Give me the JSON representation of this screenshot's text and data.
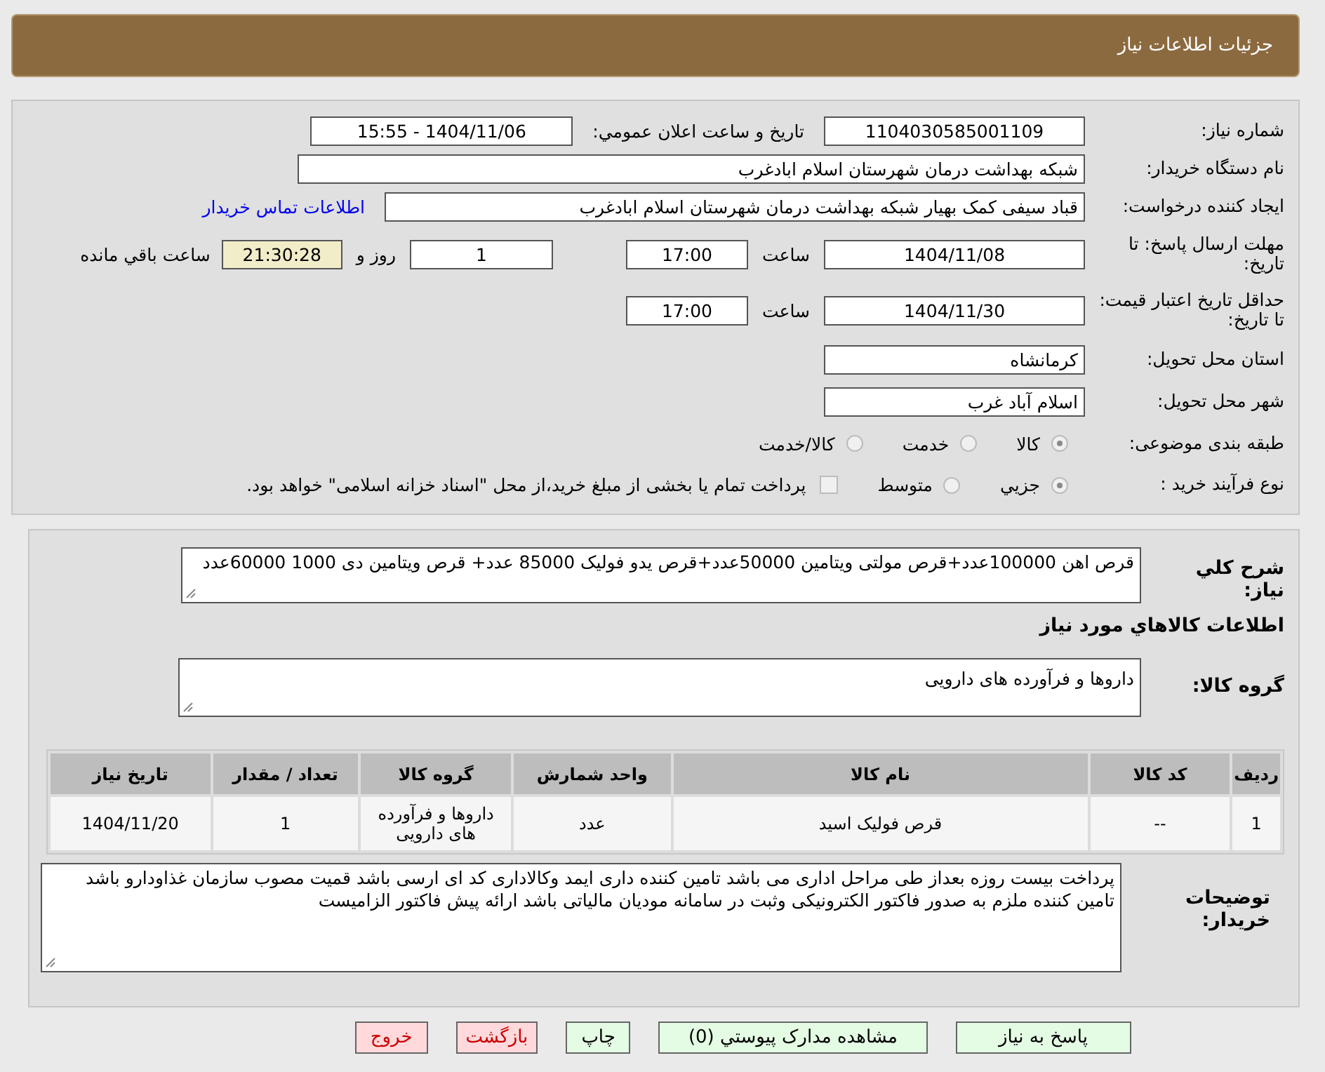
{
  "header": {
    "title": "جزئیات اطلاعات نیاز"
  },
  "need_number": {
    "label": "شماره نیاز:",
    "value": "1104030585001109"
  },
  "announce": {
    "label": "تاریخ و ساعت اعلان عمومي:",
    "value": "1404/11/06 - 15:55"
  },
  "buyer": {
    "label": "نام دستگاه خریدار:",
    "value": "شبکه بهداشت درمان شهرستان اسلام ابادغرب"
  },
  "requester": {
    "label": "ایجاد کننده درخواست:",
    "value": "قباد سیفی کمک بهیار شبکه بهداشت درمان شهرستان اسلام ابادغرب",
    "link": "اطلاعات تماس خریدار"
  },
  "reply_deadline": {
    "label": "مهلت ارسال پاسخ: تا تاریخ:",
    "date": "1404/11/08",
    "time_label": "ساعت",
    "time": "17:00",
    "days": "1",
    "days_label": "روز و",
    "remaining": "21:30:28",
    "remaining_label": "ساعت باقي مانده"
  },
  "price_validity": {
    "label": "حداقل تاریخ اعتبار قیمت: تا تاریخ:",
    "date": "1404/11/30",
    "time_label": "ساعت",
    "time": "17:00"
  },
  "province": {
    "label": "استان محل تحویل:",
    "value": "کرمانشاه"
  },
  "city": {
    "label": "شهر محل تحویل:",
    "value": "اسلام آباد غرب"
  },
  "category": {
    "label": "طبقه بندی موضوعی:",
    "options": [
      {
        "label": "کالا",
        "selected": true
      },
      {
        "label": "خدمت",
        "selected": false
      },
      {
        "label": "کالا/خدمت",
        "selected": false
      }
    ]
  },
  "process": {
    "label": "نوع فرآیند خرید :",
    "options": [
      {
        "label": "جزيي",
        "selected": true
      },
      {
        "label": "متوسط",
        "selected": false
      }
    ],
    "treasury": {
      "label": "پرداخت تمام یا بخشی از مبلغ خرید،از محل \"اسناد خزانه اسلامی\" خواهد بود.",
      "checked": false
    }
  },
  "summary": {
    "label": "شرح کلي نیاز:",
    "value": "قرص اهن 100000عدد+قرص مولتی ویتامین 50000عدد+قرص یدو فولیک 85000 عدد+ قرص ویتامین دی 1000 60000عدد"
  },
  "goods_heading": "اطلاعات کالاهاي مورد نیاز",
  "goods_group": {
    "label": "گروه کالا:",
    "value": "داروها و فرآورده های دارویی"
  },
  "table": {
    "columns": [
      "ردیف",
      "کد کالا",
      "نام کالا",
      "واحد شمارش",
      "گروه کالا",
      "تعداد / مقدار",
      "تاریخ نیاز"
    ],
    "rows": [
      [
        "1",
        "--",
        "قرص فولیک اسید",
        "عدد",
        "داروها و فرآورده های دارویی",
        "1",
        "1404/11/20"
      ]
    ]
  },
  "notes": {
    "label": "توضیحات خریدار:",
    "value": "پرداخت بیست روزه بعداز طی مراحل اداری می باشد تامین کننده داری ایمد وکالاداری کد ای ارسی  باشد قمیت مصوب سازمان غذاودارو باشد تامین کننده ملزم به صدور فاکتور الکترونیکی وثبت در سامانه مودیان مالیاتی باشد ارائه پیش فاکتور الزامیست"
  },
  "buttons": [
    {
      "label": "پاسخ به نیاز",
      "kind": "primary"
    },
    {
      "label": "مشاهده مدارک پیوستي (0)",
      "kind": "primary"
    },
    {
      "label": "چاپ",
      "kind": "primary"
    },
    {
      "label": "بازگشت",
      "kind": "danger"
    },
    {
      "label": "خروج",
      "kind": "danger"
    }
  ]
}
